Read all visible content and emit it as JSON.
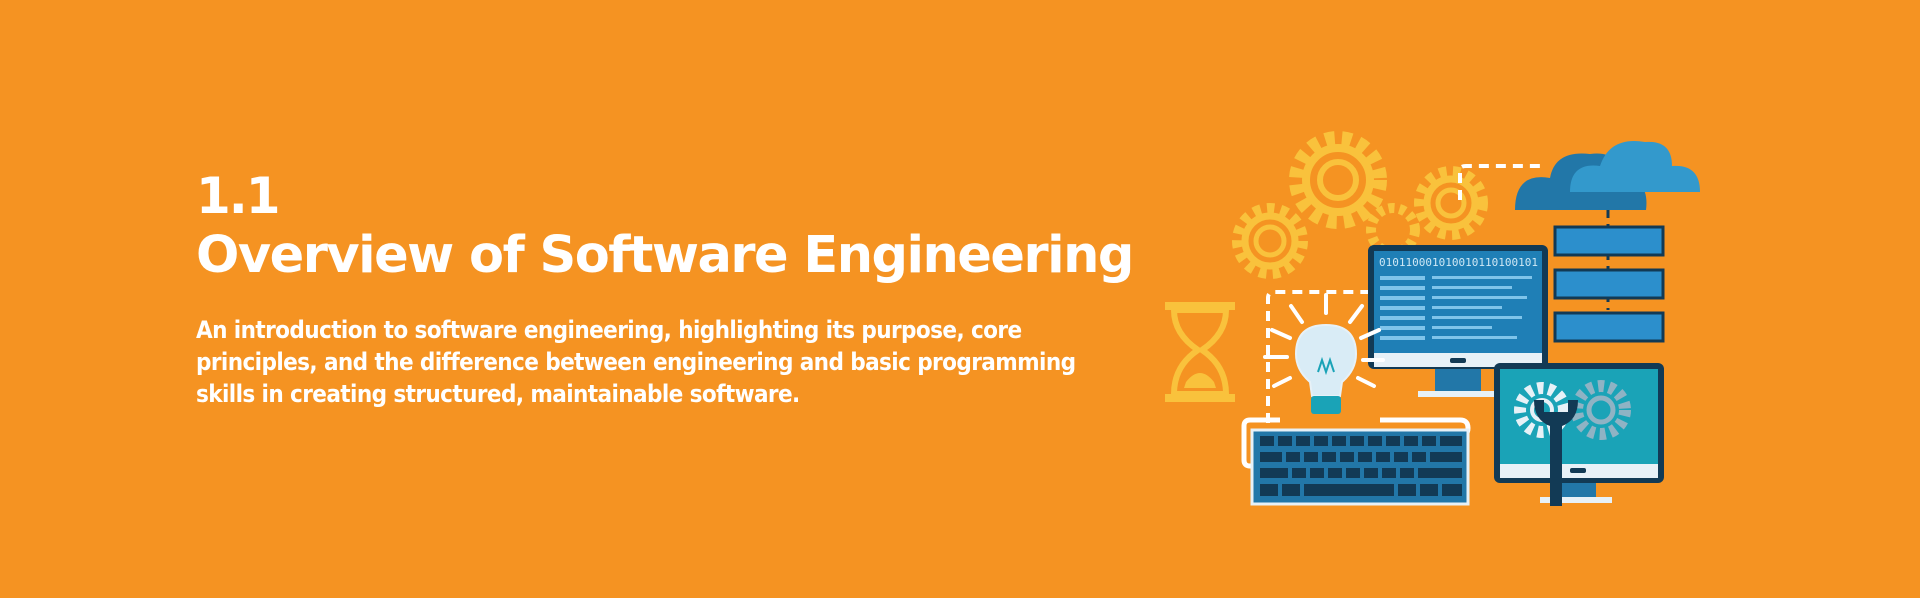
{
  "hero": {
    "section_number": "1.1",
    "title": "Overview of Software Engineering",
    "description": "An introduction to software engineering, highlighting its purpose, core principles, and the difference between engineering and basic programming skills in creating structured, maintainable software."
  },
  "illustration": {
    "monitor_code_text": "010110001010010110100101",
    "icons": [
      "gear-icon",
      "cloud-icon",
      "server-rack-icon",
      "hourglass-icon",
      "lightbulb-icon",
      "monitor-icon",
      "keyboard-icon",
      "wrench-icon"
    ]
  },
  "colors": {
    "background": "#f59322",
    "text": "#ffffff",
    "gear_yellow": "#f9c23c",
    "cloud_dark": "#2277a8",
    "cloud_light": "#3399cc",
    "teal": "#1aa3b7",
    "navy": "#123a55"
  }
}
